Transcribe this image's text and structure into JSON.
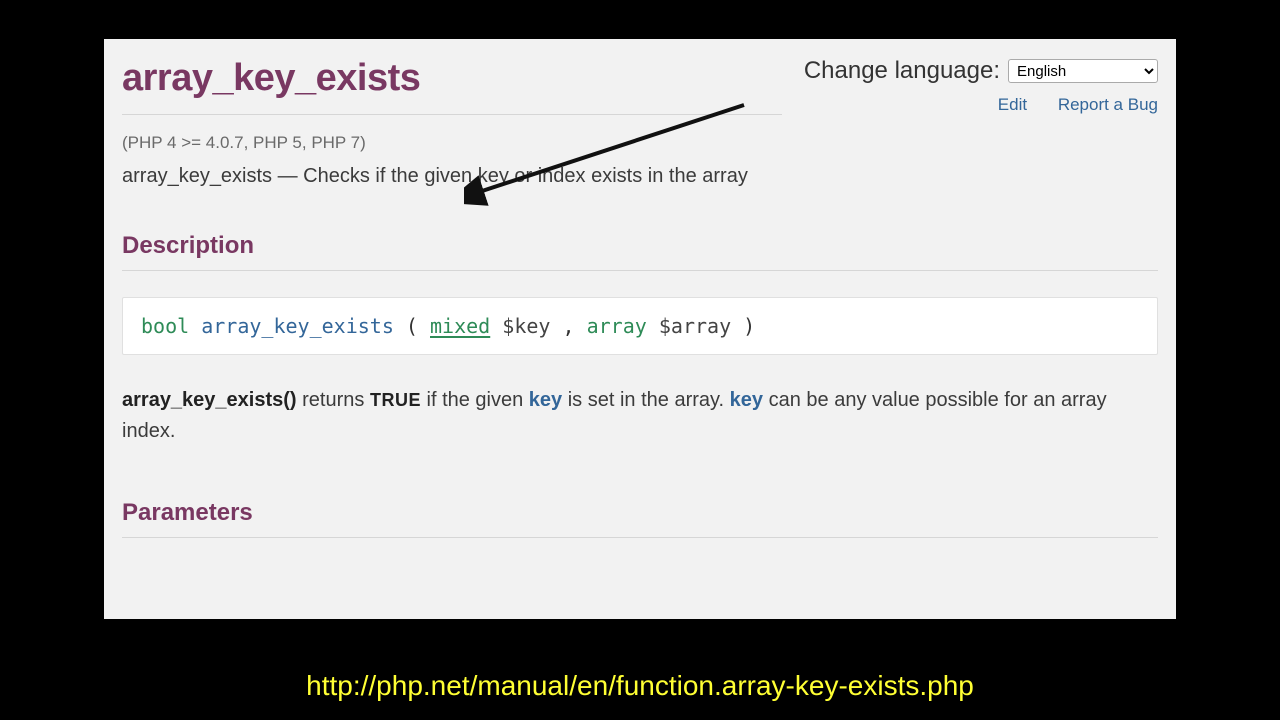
{
  "title": "array_key_exists",
  "lang": {
    "label": "Change language:",
    "selected": "English"
  },
  "actions": {
    "edit": "Edit",
    "report": "Report a Bug"
  },
  "version": "(PHP 4 >= 4.0.7, PHP 5, PHP 7)",
  "summary": "array_key_exists — Checks if the given key or index exists in the array",
  "sections": {
    "description": "Description",
    "parameters": "Parameters"
  },
  "synopsis": {
    "ret": "bool",
    "fn": "array_key_exists",
    "p1type": "mixed",
    "p1var": "$key",
    "p2type": "array",
    "p2var": "$array"
  },
  "desc": {
    "fnref": "array_key_exists()",
    "t1": " returns ",
    "const": "TRUE",
    "t2": " if the given ",
    "kw1": "key",
    "t3": " is set in the array. ",
    "kw2": "key",
    "t4": " can be any value possible for an array index."
  },
  "caption": "http://php.net/manual/en/function.array-key-exists.php"
}
